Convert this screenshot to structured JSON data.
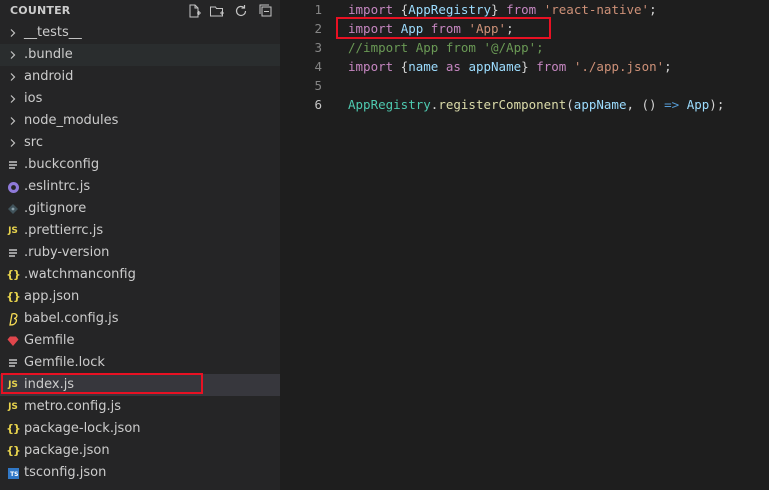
{
  "explorer": {
    "title": "COUNTER",
    "actions": [
      {
        "name": "new-file-icon"
      },
      {
        "name": "new-folder-icon"
      },
      {
        "name": "refresh-icon"
      },
      {
        "name": "collapse-all-icon"
      }
    ],
    "items": [
      {
        "label": "__tests__",
        "kind": "folder",
        "icon": "chevron-right-icon"
      },
      {
        "label": ".bundle",
        "kind": "folder",
        "icon": "chevron-right-icon"
      },
      {
        "label": "android",
        "kind": "folder",
        "icon": "chevron-right-icon"
      },
      {
        "label": "ios",
        "kind": "folder",
        "icon": "chevron-right-icon"
      },
      {
        "label": "node_modules",
        "kind": "folder",
        "icon": "chevron-right-icon"
      },
      {
        "label": "src",
        "kind": "folder",
        "icon": "chevron-right-icon"
      },
      {
        "label": ".buckconfig",
        "kind": "file",
        "icon": "text-file-icon"
      },
      {
        "label": ".eslintrc.js",
        "kind": "file",
        "icon": "eslint-icon"
      },
      {
        "label": ".gitignore",
        "kind": "file",
        "icon": "git-icon"
      },
      {
        "label": ".prettierrc.js",
        "kind": "file",
        "icon": "js-file-icon"
      },
      {
        "label": ".ruby-version",
        "kind": "file",
        "icon": "text-file-icon"
      },
      {
        "label": ".watchmanconfig",
        "kind": "file",
        "icon": "json-file-icon"
      },
      {
        "label": "app.json",
        "kind": "file",
        "icon": "json-file-icon"
      },
      {
        "label": "babel.config.js",
        "kind": "file",
        "icon": "babel-icon"
      },
      {
        "label": "Gemfile",
        "kind": "file",
        "icon": "ruby-icon"
      },
      {
        "label": "Gemfile.lock",
        "kind": "file",
        "icon": "text-file-icon"
      },
      {
        "label": "index.js",
        "kind": "file",
        "icon": "js-file-icon"
      },
      {
        "label": "metro.config.js",
        "kind": "file",
        "icon": "js-file-icon"
      },
      {
        "label": "package-lock.json",
        "kind": "file",
        "icon": "json-file-icon"
      },
      {
        "label": "package.json",
        "kind": "file",
        "icon": "json-file-icon"
      },
      {
        "label": "tsconfig.json",
        "kind": "file",
        "icon": "ts-file-icon"
      }
    ],
    "icon_glyphs": {
      "js": "JS",
      "json": "{}",
      "ts": "TS"
    }
  },
  "editor": {
    "lines": [
      {
        "number": "1",
        "tokens": [
          {
            "t": "import",
            "c": "kw"
          },
          {
            "t": " {",
            "c": "punc"
          },
          {
            "t": "AppRegistry",
            "c": "var"
          },
          {
            "t": "} ",
            "c": "punc"
          },
          {
            "t": "from",
            "c": "kw"
          },
          {
            "t": " ",
            "c": "punc"
          },
          {
            "t": "'react-native'",
            "c": "str"
          },
          {
            "t": ";",
            "c": "punc"
          }
        ]
      },
      {
        "number": "2",
        "tokens": [
          {
            "t": "import",
            "c": "kw"
          },
          {
            "t": " ",
            "c": "punc"
          },
          {
            "t": "App",
            "c": "var"
          },
          {
            "t": " ",
            "c": "punc"
          },
          {
            "t": "from",
            "c": "kw"
          },
          {
            "t": " ",
            "c": "punc"
          },
          {
            "t": "'App'",
            "c": "str"
          },
          {
            "t": ";",
            "c": "punc"
          }
        ]
      },
      {
        "number": "3",
        "tokens": [
          {
            "t": "//import App from '@/App';",
            "c": "cmt"
          }
        ]
      },
      {
        "number": "4",
        "tokens": [
          {
            "t": "import",
            "c": "kw"
          },
          {
            "t": " {",
            "c": "punc"
          },
          {
            "t": "name",
            "c": "var"
          },
          {
            "t": " ",
            "c": "punc"
          },
          {
            "t": "as",
            "c": "kw"
          },
          {
            "t": " ",
            "c": "punc"
          },
          {
            "t": "appName",
            "c": "var"
          },
          {
            "t": "} ",
            "c": "punc"
          },
          {
            "t": "from",
            "c": "kw"
          },
          {
            "t": " ",
            "c": "punc"
          },
          {
            "t": "'./app.json'",
            "c": "str"
          },
          {
            "t": ";",
            "c": "punc"
          }
        ]
      },
      {
        "number": "5",
        "tokens": []
      },
      {
        "number": "6",
        "tokens": [
          {
            "t": "AppRegistry",
            "c": "cls"
          },
          {
            "t": ".",
            "c": "punc"
          },
          {
            "t": "registerComponent",
            "c": "fn"
          },
          {
            "t": "(",
            "c": "punc"
          },
          {
            "t": "appName",
            "c": "var"
          },
          {
            "t": ", () ",
            "c": "punc"
          },
          {
            "t": "=>",
            "c": "op"
          },
          {
            "t": " ",
            "c": "punc"
          },
          {
            "t": "App",
            "c": "var"
          },
          {
            "t": ");",
            "c": "punc"
          }
        ]
      }
    ],
    "active_line": "6"
  },
  "colors": {
    "highlight_border": "#e81123",
    "sidebar_bg": "#252526",
    "editor_bg": "#1e1e1e"
  }
}
